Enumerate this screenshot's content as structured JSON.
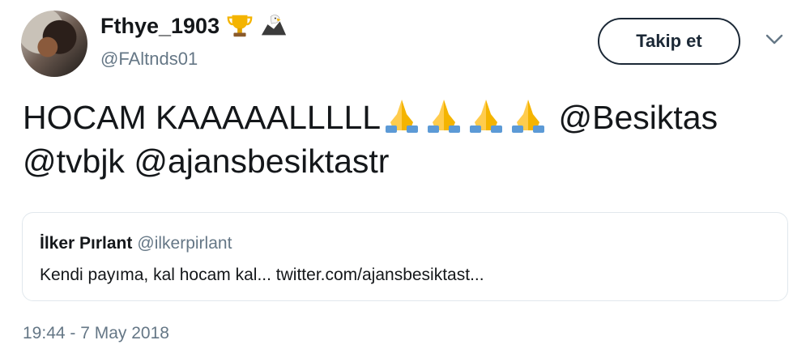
{
  "user": {
    "display_name": "Fthye_1903",
    "handle": "@FAltnds01",
    "badges": [
      "trophy-emoji",
      "eagle-emoji"
    ]
  },
  "follow_button": {
    "label": "Takip et"
  },
  "tweet": {
    "text_prefix": "HOCAM KAAAAALLLLL",
    "emoji_count": 4,
    "mention_1": "@Besiktas",
    "mention_2": "@tvbjk",
    "mention_3": "@ajansbesiktastr"
  },
  "quote": {
    "author_name": "İlker Pırlant",
    "author_handle": "@ilkerpirlant",
    "text": "Kendi payıma, kal hocam kal... twitter.com/ajansbesiktast..."
  },
  "timestamp": "19:44 - 7 May 2018",
  "colors": {
    "text": "#14171a",
    "secondary": "#657786",
    "border": "#e1e8ed",
    "button_border": "#1b2836"
  }
}
